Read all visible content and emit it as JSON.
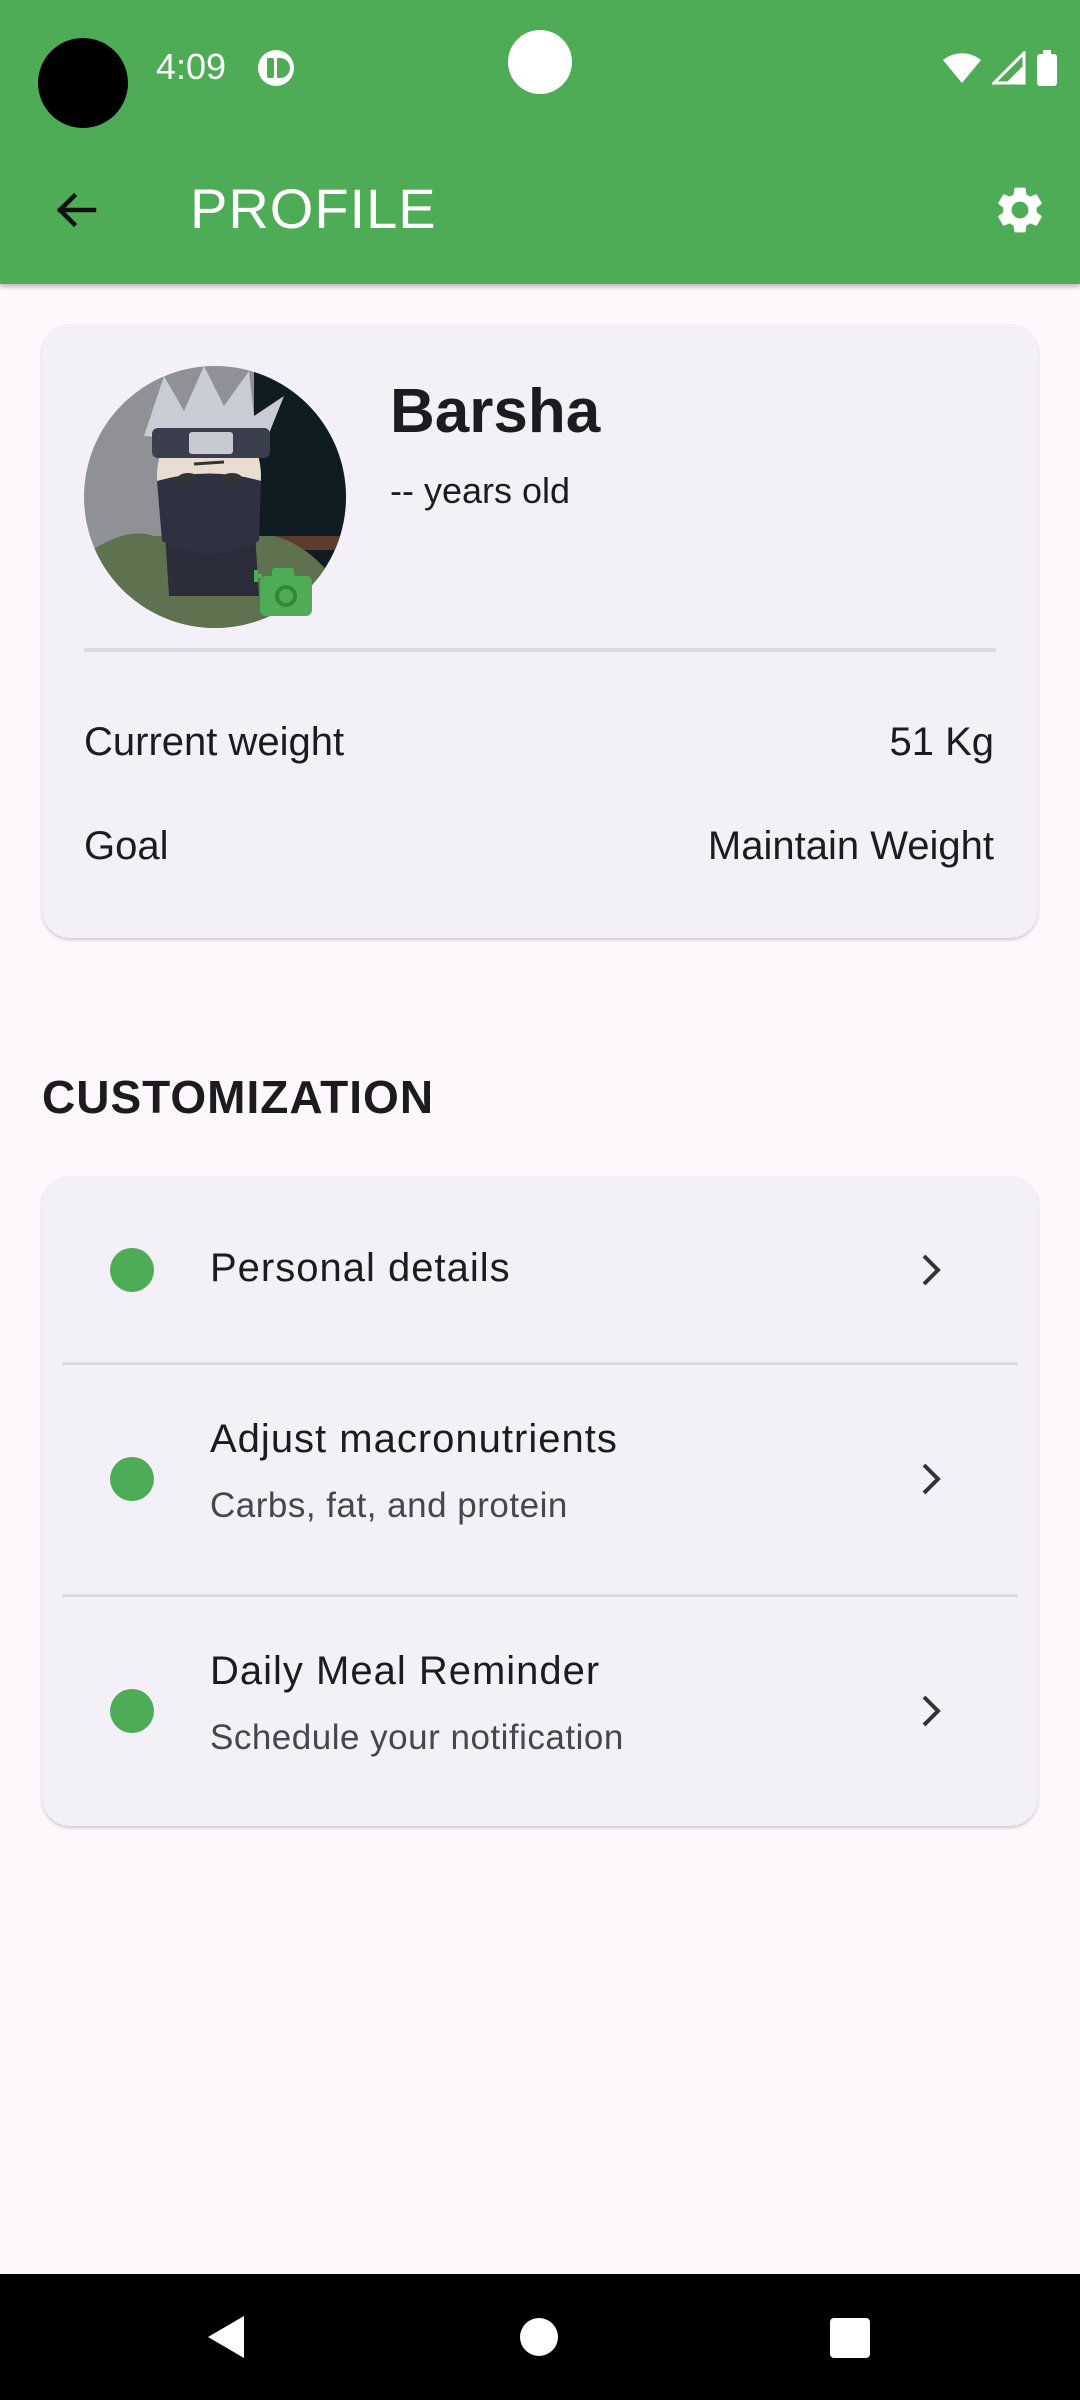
{
  "status_bar": {
    "time": "4:09",
    "app_icon": "app-notification-icon",
    "icons": [
      "wifi-icon",
      "cellular-signal-icon",
      "battery-icon"
    ]
  },
  "app_bar": {
    "title": "PROFILE",
    "back_icon": "arrow-back-icon",
    "settings_icon": "gear-icon",
    "color": "#4fac56"
  },
  "profile": {
    "name": "Barsha",
    "age_text": "-- years old",
    "avatar": "anime-character-avatar",
    "camera_icon": "camera-icon",
    "rows": [
      {
        "label": "Current weight",
        "value": "51 Kg"
      },
      {
        "label": "Goal",
        "value": "Maintain Weight"
      }
    ]
  },
  "customization": {
    "section_title": "CUSTOMIZATION",
    "items": [
      {
        "title": "Personal details",
        "subtitle": ""
      },
      {
        "title": "Adjust macronutrients",
        "subtitle": "Carbs, fat, and protein"
      },
      {
        "title": "Daily Meal Reminder",
        "subtitle": "Schedule your notification"
      }
    ],
    "accent": "#4fac56"
  },
  "nav_bar": {
    "icons": [
      "nav-back-icon",
      "nav-home-icon",
      "nav-recents-icon"
    ]
  }
}
